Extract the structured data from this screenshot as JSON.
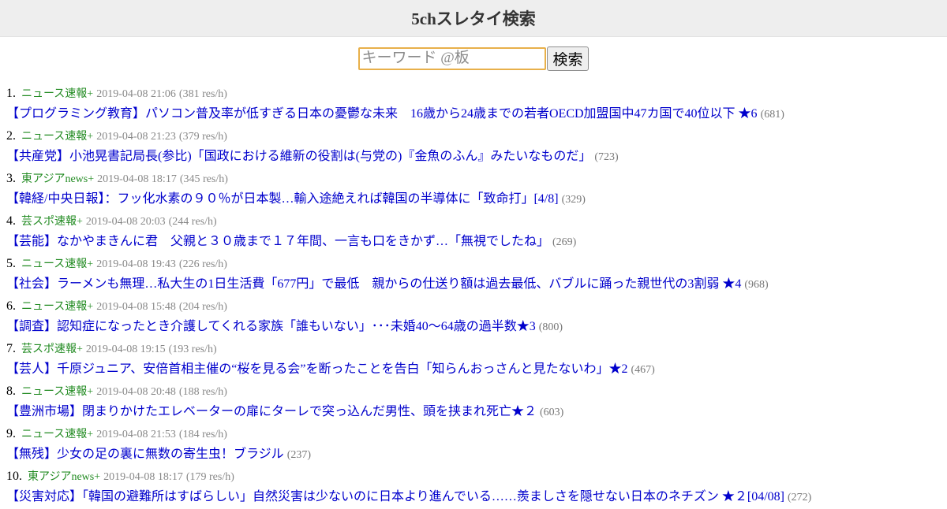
{
  "header": {
    "title": "5chスレタイ検索"
  },
  "search": {
    "placeholder": "キーワード @板",
    "value": "",
    "button_label": "検索"
  },
  "results": [
    {
      "rank": "1.",
      "board": "ニュース速報+",
      "date": "2019-04-08 21:06",
      "rate": "(381 res/h)",
      "title": "【プログラミング教育】パソコン普及率が低すぎる日本の憂鬱な未来　16歳から24歳までの若者OECD加盟国中47カ国で40位以下 ★6",
      "count": "(681)"
    },
    {
      "rank": "2.",
      "board": "ニュース速報+",
      "date": "2019-04-08 21:23",
      "rate": "(379 res/h)",
      "title": "【共産党】小池晃書記局長(参比)「国政における維新の役割は(与党の)『金魚のふん』みたいなものだ」",
      "count": "(723)"
    },
    {
      "rank": "3.",
      "board": "東アジアnews+",
      "date": "2019-04-08 18:17",
      "rate": "(345 res/h)",
      "title": "【韓経/中央日報】：フッ化水素の９０％が日本製…輸入途絶えれば韓国の半導体に「致命打」[4/8]",
      "count": "(329)"
    },
    {
      "rank": "4.",
      "board": "芸スポ速報+",
      "date": "2019-04-08 20:03",
      "rate": "(244 res/h)",
      "title": "【芸能】なかやまきんに君　父親と３０歳まで１７年間、一言も口をきかず…「無視でしたね」",
      "count": "(269)"
    },
    {
      "rank": "5.",
      "board": "ニュース速報+",
      "date": "2019-04-08 19:43",
      "rate": "(226 res/h)",
      "title": "【社会】ラーメンも無理…私大生の1日生活費「677円」で最低　親からの仕送り額は過去最低、バブルに踊った親世代の3割弱 ★4",
      "count": "(968)"
    },
    {
      "rank": "6.",
      "board": "ニュース速報+",
      "date": "2019-04-08 15:48",
      "rate": "(204 res/h)",
      "title": "【調査】認知症になったとき介護してくれる家族「誰もいない」･･･未婚40～64歳の過半数★3",
      "count": "(800)"
    },
    {
      "rank": "7.",
      "board": "芸スポ速報+",
      "date": "2019-04-08 19:15",
      "rate": "(193 res/h)",
      "title": "【芸人】千原ジュニア、安倍首相主催の“桜を見る会”を断ったことを告白「知らんおっさんと見たないわ」★2",
      "count": "(467)"
    },
    {
      "rank": "8.",
      "board": "ニュース速報+",
      "date": "2019-04-08 20:48",
      "rate": "(188 res/h)",
      "title": "【豊洲市場】閉まりかけたエレベーターの扉にターレで突っ込んだ男性、頭を挟まれ死亡★２",
      "count": "(603)"
    },
    {
      "rank": "9.",
      "board": "ニュース速報+",
      "date": "2019-04-08 21:53",
      "rate": "(184 res/h)",
      "title": "【無残】少女の足の裏に無数の寄生虫！ブラジル",
      "count": "(237)"
    },
    {
      "rank": "10.",
      "board": "東アジアnews+",
      "date": "2019-04-08 18:17",
      "rate": "(179 res/h)",
      "title": "【災害対応】「韓国の避難所はすばらしい」自然災害は少ないのに日本より進んでいる……羨ましさを隠せない日本のネチズン ★２[04/08]",
      "count": "(272)"
    }
  ]
}
